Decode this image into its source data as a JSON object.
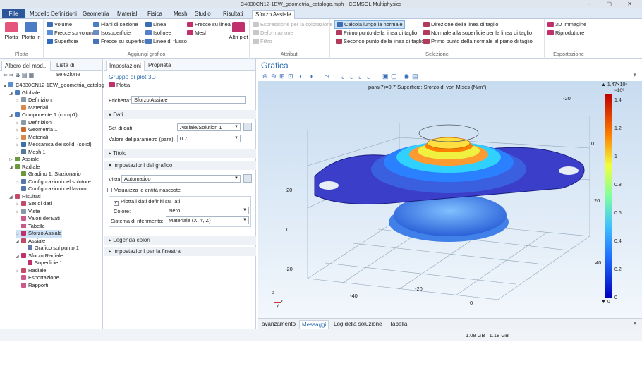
{
  "titlebar": {
    "title": "C4830CN12-1EW_geometria_catalogo.mph - COMSOL Multiphysics"
  },
  "menu": {
    "file": "File",
    "tabs": [
      "Modello",
      "Definizioni",
      "Geometria",
      "Materiali",
      "Fisica",
      "Mesh",
      "Studio",
      "Risultati",
      "Sforzo Assiale"
    ],
    "active": "Sforzo Assiale"
  },
  "ribbon": {
    "plot": {
      "btn1": "Plotta",
      "btn2": "Plotta in",
      "group": "Plotta"
    },
    "add": {
      "group": "Aggiungi grafico",
      "items": [
        "Volume",
        "Frecce su volume",
        "Superficie",
        "Piani di sezione",
        "Isosuperficie",
        "Frecce su superficie",
        "Linea",
        "Isolinee",
        "Linee di flusso",
        "Frecce su linea",
        "Mesh"
      ],
      "other": "Altri plot"
    },
    "attr": {
      "group": "Attributi",
      "items": [
        "Espressione per la colorazione",
        "Deformazione",
        "Filtro"
      ]
    },
    "sel": {
      "group": "Selezione",
      "items": [
        "Calcola lungo la normale",
        "Primo punto della linea di taglio",
        "Secondo punto della linea di taglio",
        "Direzione della linea di taglio",
        "Normale alla superficie per la linea di taglio",
        "Primo punto della normale al piano di taglio"
      ]
    },
    "exp": {
      "group": "Esportazione",
      "items": [
        "3D immagine",
        "Riproduttore"
      ]
    }
  },
  "tree": {
    "tabs": [
      "Albero del mod...",
      "Lista di selezione"
    ],
    "nodes": [
      {
        "label": "C4830CN12-1EW_geometria_catalog",
        "lvl": 0,
        "arrow": "◢",
        "color": "#5b8fd0"
      },
      {
        "label": "Globale",
        "lvl": 1,
        "arrow": "◢",
        "color": "#4a7bbf"
      },
      {
        "label": "Definizioni",
        "lvl": 2,
        "arrow": "▷",
        "color": "#8899aa"
      },
      {
        "label": "Materiali",
        "lvl": 2,
        "arrow": "",
        "color": "#d8894a"
      },
      {
        "label": "Componente 1 (comp1)",
        "lvl": 1,
        "arrow": "◢",
        "color": "#4a7bbf",
        "italic": "comp1"
      },
      {
        "label": "Definizioni",
        "lvl": 2,
        "arrow": "▷",
        "color": "#8899aa"
      },
      {
        "label": "Geometria 1",
        "lvl": 2,
        "arrow": "▷",
        "color": "#c96b2c"
      },
      {
        "label": "Materiali",
        "lvl": 2,
        "arrow": "▷",
        "color": "#d8894a"
      },
      {
        "label": "Meccanica dei solidi (solid)",
        "lvl": 2,
        "arrow": "▷",
        "color": "#3c6ea8"
      },
      {
        "label": "Mesh 1",
        "lvl": 2,
        "arrow": "▷",
        "color": "#557799"
      },
      {
        "label": "Assiale",
        "lvl": 1,
        "arrow": "▷",
        "color": "#6a9a3a"
      },
      {
        "label": "Radiale",
        "lvl": 1,
        "arrow": "◢",
        "color": "#6a9a3a"
      },
      {
        "label": "Gradino 1: Stazionario",
        "lvl": 2,
        "arrow": "",
        "color": "#6a9a3a"
      },
      {
        "label": "Configurazioni del solutore",
        "lvl": 2,
        "arrow": "▷",
        "color": "#5577aa"
      },
      {
        "label": "Configurazioni del lavoro",
        "lvl": 2,
        "arrow": "",
        "color": "#5577aa"
      },
      {
        "label": "Risultati",
        "lvl": 1,
        "arrow": "◢",
        "color": "#c44a6a"
      },
      {
        "label": "Set di dati",
        "lvl": 2,
        "arrow": "▷",
        "color": "#c44a6a"
      },
      {
        "label": "Viste",
        "lvl": 2,
        "arrow": "▷",
        "color": "#8899aa"
      },
      {
        "label": "Valori derivati",
        "lvl": 2,
        "arrow": "",
        "color": "#cc5a88"
      },
      {
        "label": "Tabelle",
        "lvl": 2,
        "arrow": "",
        "color": "#cc5a88"
      },
      {
        "label": "Sforzo Assiale",
        "lvl": 2,
        "arrow": "▷",
        "color": "#c0306a",
        "sel": true
      },
      {
        "label": "Assiale",
        "lvl": 2,
        "arrow": "◢",
        "color": "#c44a6a"
      },
      {
        "label": "Grafico sul punto 1",
        "lvl": 3,
        "arrow": "",
        "color": "#6677aa"
      },
      {
        "label": "Sforzo Radiale",
        "lvl": 2,
        "arrow": "◢",
        "color": "#c0306a"
      },
      {
        "label": "Superficie 1",
        "lvl": 3,
        "arrow": "",
        "color": "#c0306a"
      },
      {
        "label": "Radiale",
        "lvl": 2,
        "arrow": "▷",
        "color": "#c44a6a"
      },
      {
        "label": "Esportazione",
        "lvl": 2,
        "arrow": "",
        "color": "#cc5a88"
      },
      {
        "label": "Rapporti",
        "lvl": 2,
        "arrow": "",
        "color": "#cc5a88"
      }
    ]
  },
  "settings": {
    "tabs": [
      "Impostazioni",
      "Proprietà"
    ],
    "title": "Gruppo di plot 3D",
    "plot_btn": "Plotta",
    "label_lbl": "Etichetta:",
    "label_val": "Sforzo Assiale",
    "dati": "Dati",
    "dataset_lbl": "Set di dati:",
    "dataset_val": "Assiale/Solution 1",
    "param_lbl": "Valore del parametro (para):",
    "param_val": "0.7",
    "titolo": "Titolo",
    "imp": "Impostazioni del grafico",
    "vista_lbl": "Vista:",
    "vista_val": "Automatico",
    "hidden": "Visualizza le entità nascoste",
    "plotlines": "Plotta i dati definiti sui lati",
    "colore_lbl": "Colore:",
    "colore_val": "Nero",
    "sis_lbl": "Sistema di riferimento:",
    "sis_val": "Materiale  (X, Y, Z)",
    "legend": "Legenda colori",
    "window": "Impostazioni per la finestra"
  },
  "graph": {
    "title": "Grafica",
    "caption": "para(7)=0.7   Superficie: Sforzo di von Mises (N/m²)",
    "colorbar_max": "▲ 1.47×10⁶",
    "colorbar_exp": "×10⁶",
    "colorbar_min": "▼ 0",
    "ticks": [
      "1.4",
      "1.2",
      "1",
      "0.8",
      "0.6",
      "0.4",
      "0.2",
      "0"
    ],
    "axis": {
      "t1": "-20",
      "t2": "0",
      "t3": "20",
      "t4": "20",
      "t5": "0",
      "t6": "-20",
      "t7": "-40",
      "t8": "40",
      "t9": "0",
      "t10": "-20"
    }
  },
  "bottom": {
    "tabs": [
      "avanzamento",
      "Messaggi",
      "Log della soluzione",
      "Tabella"
    ],
    "active": "Messaggi"
  },
  "status": {
    "memory": "1.08 GB | 1.18 GB"
  }
}
